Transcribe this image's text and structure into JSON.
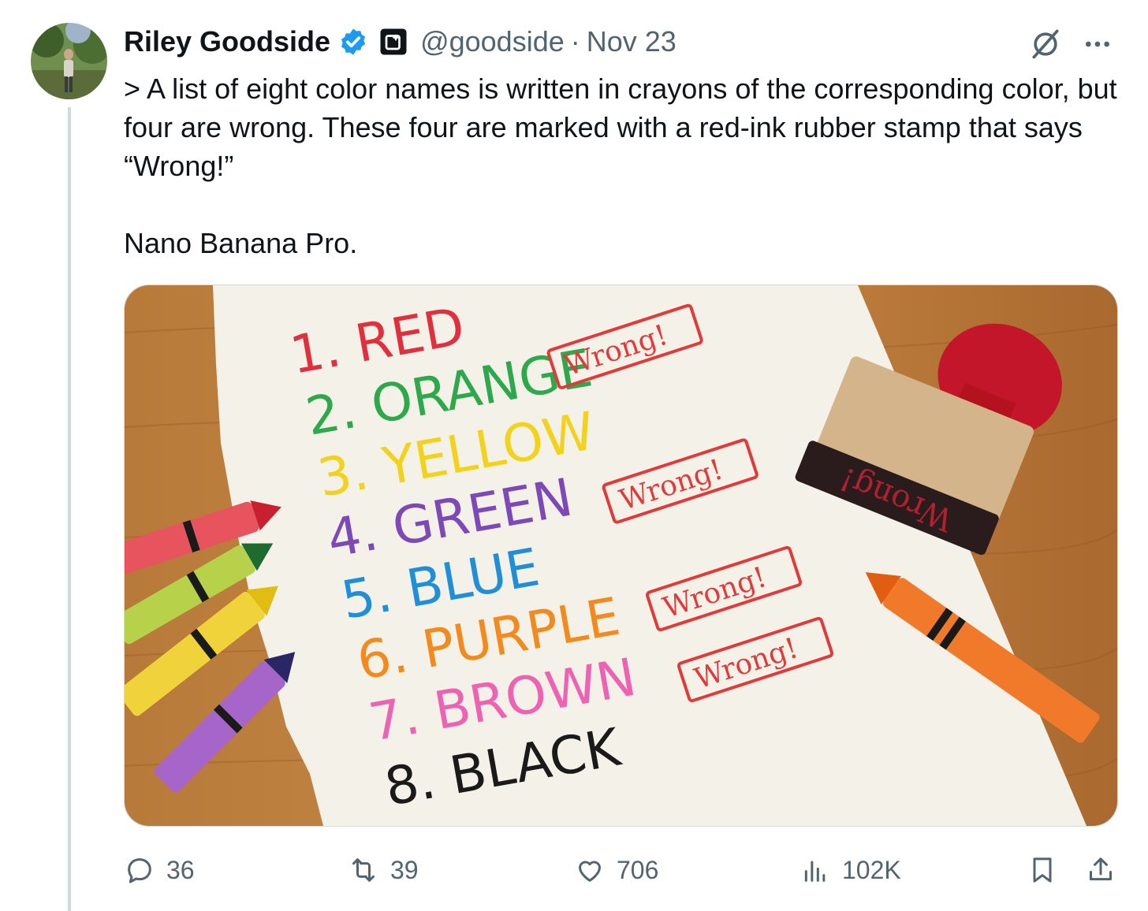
{
  "author": {
    "name": "Riley Goodside",
    "handle": "@goodside",
    "separator": "·",
    "date": "Nov 23"
  },
  "tweet": {
    "text_line1": "> A list of eight color names is written in crayons of the corresponding color, but four are wrong. These four are marked with a red-ink rubber stamp that says “Wrong!”",
    "text_line2": "Nano Banana Pro."
  },
  "image": {
    "list": [
      {
        "label": "1. RED",
        "color": "#e0303e"
      },
      {
        "label": "2. ORANGE",
        "color": "#2da84a"
      },
      {
        "label": "3. YELLOW",
        "color": "#f2d21a"
      },
      {
        "label": "4. GREEN",
        "color": "#7d48b8"
      },
      {
        "label": "5. BLUE",
        "color": "#1f8fd8"
      },
      {
        "label": "6. PURPLE",
        "color": "#f28a1e"
      },
      {
        "label": "7. BROWN",
        "color": "#ee62b3"
      },
      {
        "label": "8. BLACK",
        "color": "#1a1a1a"
      }
    ],
    "stamp_text": "Wrong!",
    "stamp_block_text": "Wrong!"
  },
  "actions": {
    "replies": "36",
    "reposts": "39",
    "likes": "706",
    "views": "102K"
  },
  "icons": [
    "verified-badge-icon",
    "affiliate-badge-icon",
    "grok-icon",
    "more-icon",
    "reply-icon",
    "repost-icon",
    "like-icon",
    "views-icon",
    "bookmark-icon",
    "share-icon"
  ],
  "colors": {
    "accent": "#1d9bf0",
    "muted": "#536471",
    "text": "#0f1419",
    "border": "#cfd9de"
  }
}
